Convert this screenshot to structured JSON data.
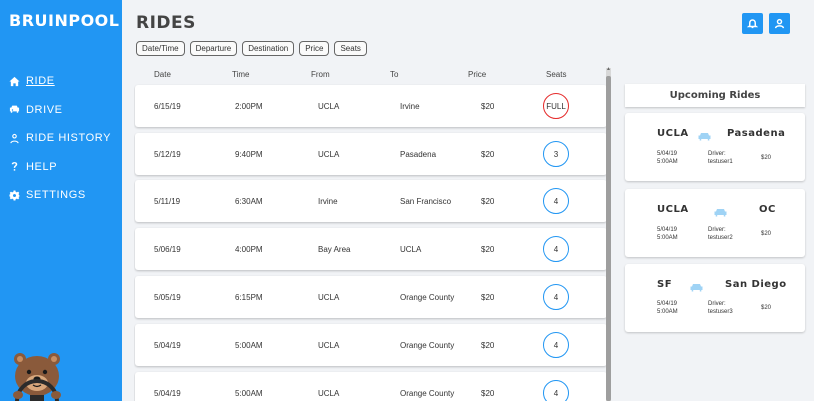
{
  "app": {
    "brand": "BRUINPOOL"
  },
  "sidebar": {
    "items": [
      {
        "label": "RIDE",
        "icon": "home-icon",
        "active": true
      },
      {
        "label": "DRIVE",
        "icon": "car-icon",
        "active": false
      },
      {
        "label": "RIDE HISTORY",
        "icon": "user-icon",
        "active": false
      },
      {
        "label": "HELP",
        "icon": "question-icon",
        "active": false
      },
      {
        "label": "SETTINGS",
        "icon": "gear-icon",
        "active": false
      }
    ],
    "mascot": "bear-mascot-icon"
  },
  "header": {
    "title": "RIDES",
    "notification_icon": "bell-icon",
    "profile_icon": "user-icon"
  },
  "filters": [
    "Date/Time",
    "Departure",
    "Destination",
    "Price",
    "Seats"
  ],
  "table": {
    "columns": [
      "Date",
      "Time",
      "From",
      "To",
      "Price",
      "Seats"
    ],
    "rows": [
      {
        "date": "6/15/19",
        "time": "2:00PM",
        "from": "UCLA",
        "to": "Irvine",
        "price": "$20",
        "seats": "FULL",
        "full": true
      },
      {
        "date": "5/12/19",
        "time": "9:40PM",
        "from": "UCLA",
        "to": "Pasadena",
        "price": "$20",
        "seats": "3",
        "full": false
      },
      {
        "date": "5/11/19",
        "time": "6:30AM",
        "from": "Irvine",
        "to": "San Francisco",
        "price": "$20",
        "seats": "4",
        "full": false
      },
      {
        "date": "5/06/19",
        "time": "4:00PM",
        "from": "Bay Area",
        "to": "UCLA",
        "price": "$20",
        "seats": "4",
        "full": false
      },
      {
        "date": "5/05/19",
        "time": "6:15PM",
        "from": "UCLA",
        "to": "Orange County",
        "price": "$20",
        "seats": "4",
        "full": false
      },
      {
        "date": "5/04/19",
        "time": "5:00AM",
        "from": "UCLA",
        "to": "Orange County",
        "price": "$20",
        "seats": "4",
        "full": false
      },
      {
        "date": "5/04/19",
        "time": "5:00AM",
        "from": "UCLA",
        "to": "Orange County",
        "price": "$20",
        "seats": "4",
        "full": false
      }
    ]
  },
  "upcoming": {
    "title": "Upcoming Rides",
    "cards": [
      {
        "from": "UCLA",
        "to": "Pasadena",
        "date": "5/04/19",
        "time": "5:00AM",
        "driver_label": "Driver:",
        "driver": "testuser1",
        "price": "$20"
      },
      {
        "from": "UCLA",
        "to": "OC",
        "date": "5/04/19",
        "time": "5:00AM",
        "driver_label": "Driver:",
        "driver": "testuser2",
        "price": "$20"
      },
      {
        "from": "SF",
        "to": "San Diego",
        "date": "5/04/19",
        "time": "5:00AM",
        "driver_label": "Driver:",
        "driver": "testuser3",
        "price": "$20"
      }
    ]
  },
  "colors": {
    "accent": "#2196f3",
    "full": "#e52a2a",
    "background": "#f1f3f6"
  }
}
